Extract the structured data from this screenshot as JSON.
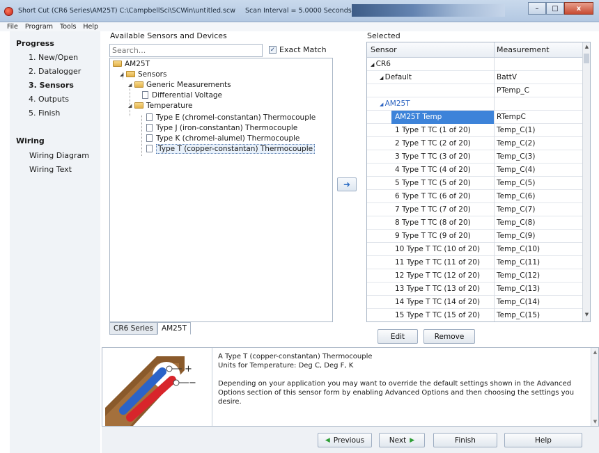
{
  "window": {
    "title": "Short Cut (CR6 Series\\AM25T) C:\\CampbellSci\\SCWin\\untitled.scw",
    "scan_interval": "Scan Interval = 5.0000 Seconds",
    "btn_min": "–",
    "btn_max": "□",
    "btn_close": "x"
  },
  "menu": [
    "File",
    "Program",
    "Tools",
    "Help"
  ],
  "progress": {
    "heading": "Progress",
    "steps": [
      "1. New/Open",
      "2. Datalogger",
      "3. Sensors",
      "4. Outputs",
      "5. Finish"
    ],
    "active_index": 2
  },
  "wiring": {
    "heading": "Wiring",
    "items": [
      "Wiring Diagram",
      "Wiring Text"
    ]
  },
  "available": {
    "label": "Available Sensors and Devices",
    "search_placeholder": "Search...",
    "exact_match_label": "Exact Match",
    "exact_match_checked": true,
    "tree": [
      {
        "label": "AM25T",
        "type": "folder",
        "depth": 0
      },
      {
        "label": "Sensors",
        "type": "folder",
        "depth": 1
      },
      {
        "label": "Generic Measurements",
        "type": "folder",
        "depth": 2
      },
      {
        "label": "Differential Voltage",
        "type": "doc",
        "depth": 3
      },
      {
        "label": "Temperature",
        "type": "folder",
        "depth": 2
      },
      {
        "label": "Type E (chromel-constantan) Thermocouple",
        "type": "doc",
        "depth": 3
      },
      {
        "label": "Type J (iron-constantan) Thermocouple",
        "type": "doc",
        "depth": 3
      },
      {
        "label": "Type K (chromel-alumel) Thermocouple",
        "type": "doc",
        "depth": 3
      },
      {
        "label": "Type T (copper-constantan) Thermocouple",
        "type": "doc",
        "depth": 3,
        "selected": true
      }
    ],
    "tabs": [
      "CR6 Series",
      "AM25T"
    ],
    "active_tab": 1
  },
  "add_arrow": "➜",
  "selected": {
    "label": "Selected",
    "columns": [
      "Sensor",
      "Measurement"
    ],
    "rows": [
      {
        "sensor": "CR6",
        "measurement": "",
        "level": 0,
        "expander": true
      },
      {
        "sensor": "Default",
        "measurement": "BattV",
        "level": 1,
        "expander": true
      },
      {
        "sensor": "",
        "measurement": "PTemp_C",
        "level": 2
      },
      {
        "sensor": "AM25T",
        "measurement": "",
        "level": 1,
        "expander": true,
        "accent": true
      },
      {
        "sensor": "AM25T Temp",
        "measurement": "RTempC",
        "level": 2,
        "highlight": true
      },
      {
        "sensor": "1 Type T TC (1 of 20)",
        "measurement": "Temp_C(1)",
        "level": 2
      },
      {
        "sensor": "2 Type T TC (2 of 20)",
        "measurement": "Temp_C(2)",
        "level": 2
      },
      {
        "sensor": "3 Type T TC (3 of 20)",
        "measurement": "Temp_C(3)",
        "level": 2
      },
      {
        "sensor": "4 Type T TC (4 of 20)",
        "measurement": "Temp_C(4)",
        "level": 2
      },
      {
        "sensor": "5 Type T TC (5 of 20)",
        "measurement": "Temp_C(5)",
        "level": 2
      },
      {
        "sensor": "6 Type T TC (6 of 20)",
        "measurement": "Temp_C(6)",
        "level": 2
      },
      {
        "sensor": "7 Type T TC (7 of 20)",
        "measurement": "Temp_C(7)",
        "level": 2
      },
      {
        "sensor": "8 Type T TC (8 of 20)",
        "measurement": "Temp_C(8)",
        "level": 2
      },
      {
        "sensor": "9 Type T TC (9 of 20)",
        "measurement": "Temp_C(9)",
        "level": 2
      },
      {
        "sensor": "10 Type T TC (10 of 20)",
        "measurement": "Temp_C(10)",
        "level": 2
      },
      {
        "sensor": "11 Type T TC (11 of 20)",
        "measurement": "Temp_C(11)",
        "level": 2
      },
      {
        "sensor": "12 Type T TC (12 of 20)",
        "measurement": "Temp_C(12)",
        "level": 2
      },
      {
        "sensor": "13 Type T TC (13 of 20)",
        "measurement": "Temp_C(13)",
        "level": 2
      },
      {
        "sensor": "14 Type T TC (14 of 20)",
        "measurement": "Temp_C(14)",
        "level": 2
      },
      {
        "sensor": "15 Type T TC (15 of 20)",
        "measurement": "Temp_C(15)",
        "level": 2
      }
    ],
    "edit_label": "Edit",
    "remove_label": "Remove"
  },
  "description": {
    "text": "A Type T (copper-constantan) Thermocouple\nUnits for Temperature: Deg C, Deg F, K\n\nDepending on your application you may want to override the default settings shown in the Advanced Options section of this sensor form by enabling Advanced Options and then choosing the settings you desire.",
    "plus": "+",
    "minus": "−",
    "wire_colors": {
      "blue": "#2b63c8",
      "red": "#d8252b",
      "jacket": "#8a5a2b"
    }
  },
  "footer": {
    "previous": "Previous",
    "next": "Next",
    "finish": "Finish",
    "help": "Help",
    "prev_arrow": "◀",
    "next_arrow": "▶"
  },
  "colors": {
    "selection": "#3d83d9",
    "accent_link": "#2a62c0",
    "arrow_green": "#2e9e35"
  }
}
